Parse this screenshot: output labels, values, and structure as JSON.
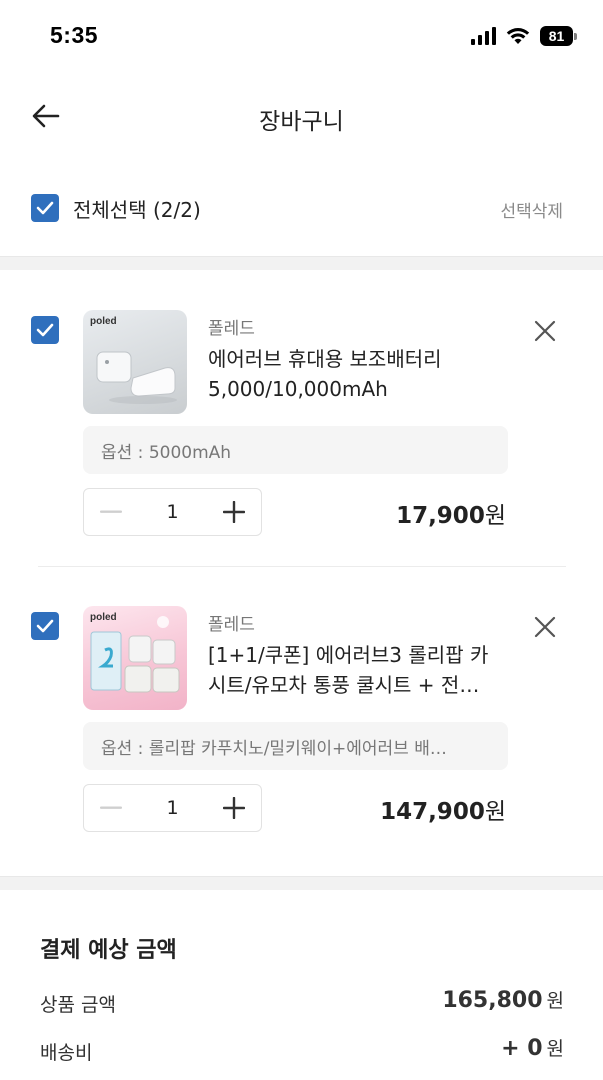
{
  "status_bar": {
    "time": "5:35",
    "battery": "81",
    "icons": [
      "signal-icon",
      "wifi-icon",
      "battery-icon"
    ]
  },
  "header": {
    "title": "장바구니",
    "back_icon": "arrow-left-icon"
  },
  "select_all": {
    "label": "전체선택 (2/2)",
    "checked": true,
    "delete_label": "선택삭제"
  },
  "items": [
    {
      "checked": true,
      "thumb_logo": "poled",
      "brand": "폴레드",
      "title_line1": "에어러브 휴대용 보조배터리",
      "title_line2": "5,000/10,000mAh",
      "option": "옵션 : 5000mAh",
      "quantity": "1",
      "price": "17,900",
      "price_unit": "원"
    },
    {
      "checked": true,
      "thumb_logo": "poled",
      "brand": "폴레드",
      "title_line1": "[1+1/쿠폰] 에어러브3 롤리팝 카",
      "title_line2": "시트/유모차 통풍 쿨시트 + 전…",
      "option": "옵션 : 롤리팝 카푸치노/밀키웨이+에어러브 배…",
      "quantity": "1",
      "price": "147,900",
      "price_unit": "원"
    }
  ],
  "summary": {
    "title": "결제 예상 금액",
    "rows": [
      {
        "label": "상품 금액",
        "value": "165,800",
        "unit": "원"
      },
      {
        "label": "배송비",
        "value": "+ 0",
        "unit": "원"
      }
    ]
  },
  "colors": {
    "accent": "#2f6fbd",
    "divider": "#f2f2f2",
    "muted_text": "#8a8a8a"
  }
}
